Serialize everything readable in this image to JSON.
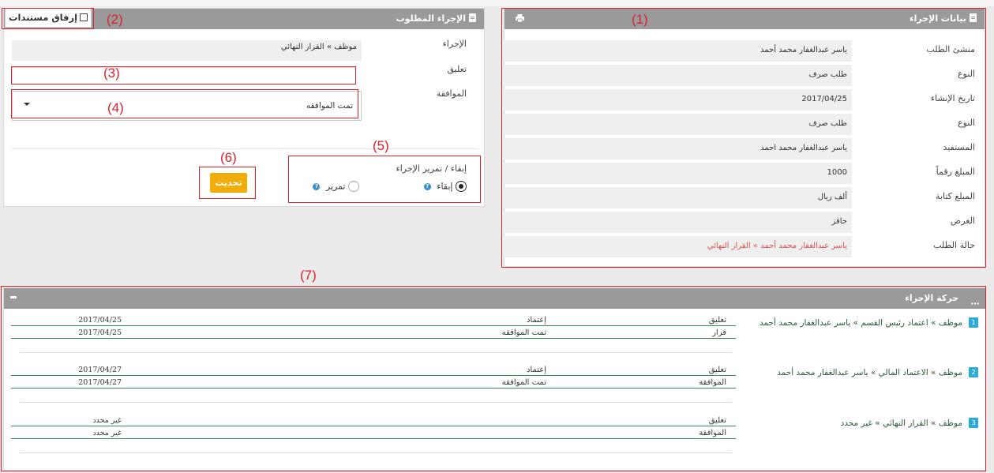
{
  "annotations": [
    "(1)",
    "(2)",
    "(3)",
    "(4)",
    "(5)",
    "(6)",
    "(7)"
  ],
  "request_panel": {
    "title": "بيانات الإجراء",
    "print_icon": "print-icon",
    "rows": [
      {
        "label": "منشئ الطلب",
        "value": "ياسر عبدالغفار محمد أحمد"
      },
      {
        "label": "النوع",
        "value": "طلب صرف"
      },
      {
        "label": "تاريخ الإنشاء",
        "value": "2017/04/25"
      },
      {
        "label": "النوع",
        "value": "طلب صرف"
      },
      {
        "label": "المستفيد",
        "value": "ياسر عبدالغفار محمد احمد"
      },
      {
        "label": "المبلغ رقماً",
        "value": "1000"
      },
      {
        "label": "المبلغ كتابة",
        "value": "ألف ريال"
      },
      {
        "label": "الغرض",
        "value": "حافز"
      },
      {
        "label": "حالة الطلب",
        "value": "ياسر عبدالغفار محمد أحمد » القرار النهائي",
        "color": "#d9534f"
      }
    ]
  },
  "action_panel": {
    "title": "الإجراء المطلوب",
    "attach_button": "إرفاق مستندات",
    "procedure_label": "الإجراء",
    "procedure_value": "موظف » القرار النهائي",
    "comment_label": "تعليق",
    "comment_value": "",
    "approval_label": "الموافقة",
    "approval_selected": "تمت الموافقه",
    "keep_pass_label": "إبقاء / تمرير الإجراء",
    "keep_option": "إبقاء",
    "pass_option": "تمرير",
    "help_mark": "?",
    "update_button": "تحديث"
  },
  "timeline": {
    "title": "حركة الإجراء",
    "steps": [
      {
        "num": "1",
        "title": "موظف » اعتماد رئيس القسم » ياسر عبدالغفار محمد أحمد",
        "lines": [
          {
            "c1": "تعليق",
            "c2": "إعتماد",
            "c3": "2017/04/25"
          },
          {
            "c1": "قرار",
            "c2": "تمت الموافقه",
            "c3": "2017/04/25"
          }
        ]
      },
      {
        "num": "2",
        "title": "موظف » الاعتماد المالي » ياسر عبدالغفار محمد أحمد",
        "lines": [
          {
            "c1": "تعليق",
            "c2": "إعتماد",
            "c3": "2017/04/27"
          },
          {
            "c1": "الموافقة",
            "c2": "تمت الموافقه",
            "c3": "2017/04/27"
          }
        ]
      },
      {
        "num": "3",
        "title": "موظف » القرار النهائي »  غير محدد",
        "lines": [
          {
            "c1": "تعليق",
            "c2": "",
            "c3": "غير محدد"
          },
          {
            "c1": "الموافقة",
            "c2": "",
            "c3": "غير محدد"
          }
        ]
      }
    ]
  },
  "colors": {
    "header": "#9a9a9a",
    "annotation": "#d9222e",
    "button": "#f0ad0a",
    "status": "#d9534f",
    "step_badge": "#2eaad9"
  }
}
